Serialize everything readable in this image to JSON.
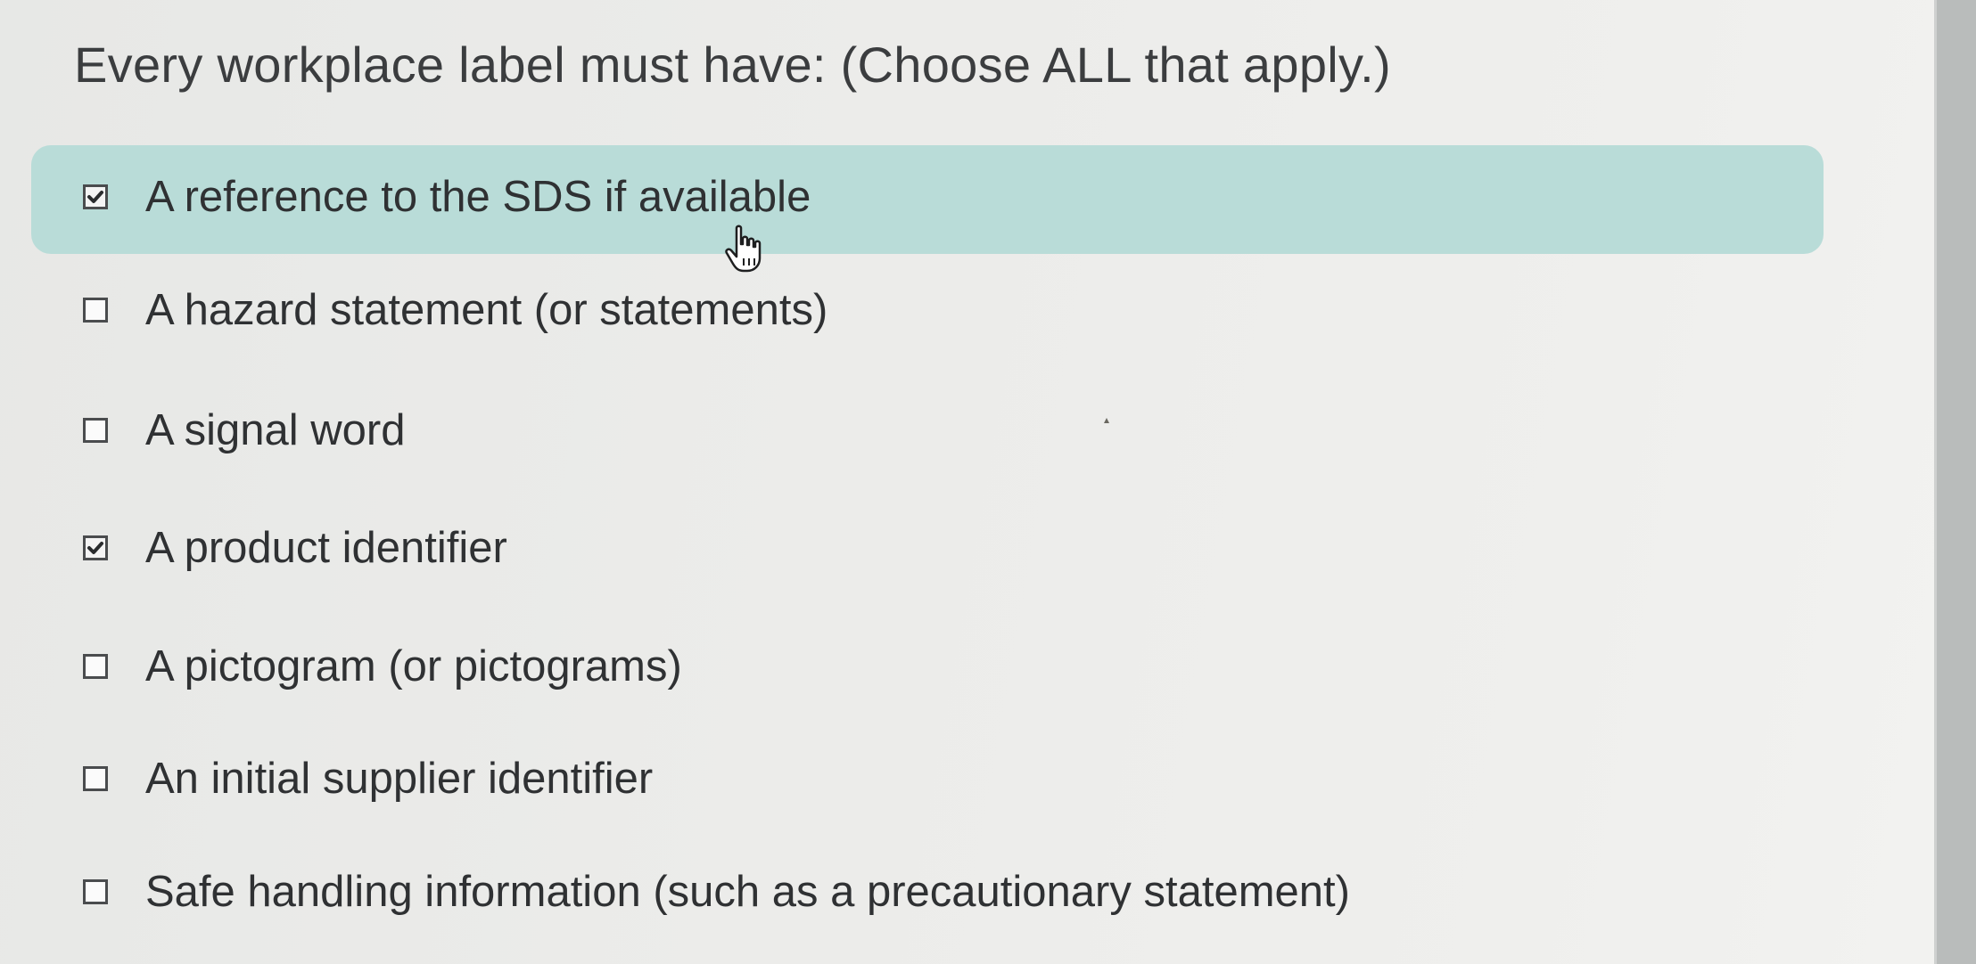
{
  "question": {
    "text": "Every workplace label must have: (Choose ALL that apply.)"
  },
  "options": [
    {
      "label": "A reference to the SDS if available",
      "checked": true,
      "hovered": true
    },
    {
      "label": "A hazard statement (or statements)",
      "checked": false,
      "hovered": false
    },
    {
      "label": "A signal word",
      "checked": false,
      "hovered": false
    },
    {
      "label": "A product identifier",
      "checked": true,
      "hovered": false
    },
    {
      "label": "A pictogram (or pictograms)",
      "checked": false,
      "hovered": false
    },
    {
      "label": "An initial supplier identifier",
      "checked": false,
      "hovered": false
    },
    {
      "label": "Safe handling information (such as a precautionary statement)",
      "checked": false,
      "hovered": false
    }
  ],
  "colors": {
    "hover_highlight": "#b9dcd8",
    "text": "#2f3133",
    "checkbox_border": "#4a4c4e"
  },
  "icons": {
    "checkmark": "checkmark-icon",
    "cursor": "hand-pointer-cursor-icon"
  }
}
